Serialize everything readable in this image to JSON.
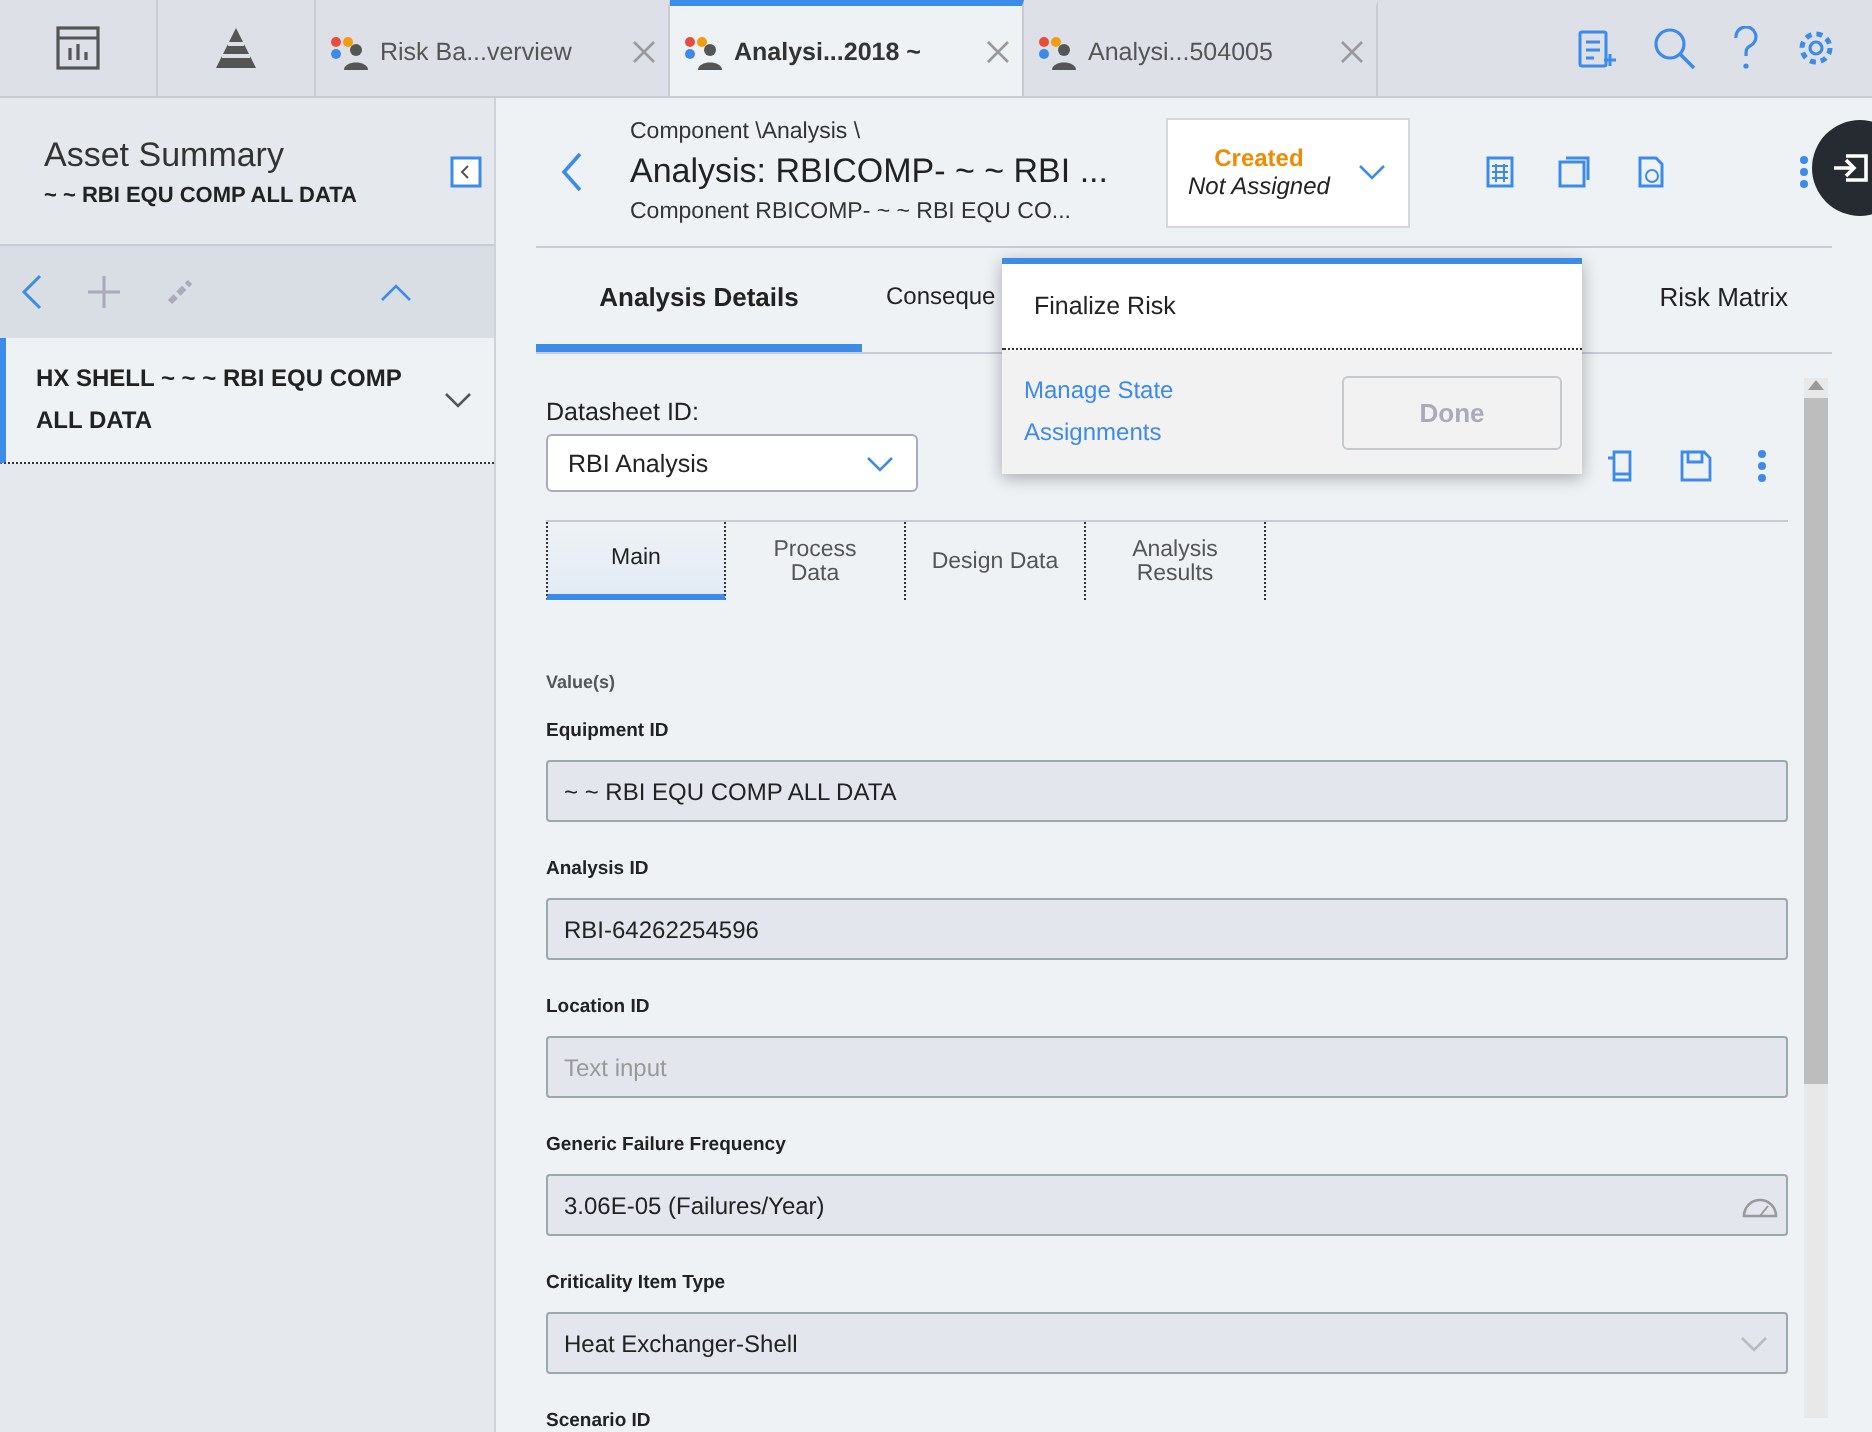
{
  "top_bar": {
    "tabs": [
      {
        "label": "Risk Ba...verview",
        "selected": false
      },
      {
        "label": "Analysi...2018 ~",
        "selected": true
      },
      {
        "label": "Analysi...504005",
        "selected": false
      }
    ]
  },
  "sidebar": {
    "title": "Asset Summary",
    "subtitle": "~ ~ RBI EQU COMP ALL DATA",
    "items": [
      {
        "label": "HX SHELL ~ ~ ~ RBI EQU COMP ALL DATA",
        "selected": true
      }
    ]
  },
  "header": {
    "breadcrumb": "Component \\Analysis \\",
    "title": "Analysis: RBICOMP- ~ ~ RBI ...",
    "subtitle": "Component RBICOMP- ~ ~ RBI EQU CO...",
    "state": {
      "name": "Created",
      "assignee": "Not Assigned"
    }
  },
  "tabs": [
    {
      "label": "Analysis Details",
      "selected": true
    },
    {
      "label": "Conseque",
      "selected": false
    },
    {
      "label": "Risk Matrix",
      "selected": false
    }
  ],
  "state_menu": {
    "title": "Finalize Risk",
    "link": "Manage State Assignments",
    "button": {
      "label": "Done",
      "disabled": true
    }
  },
  "datasheet": {
    "label": "Datasheet ID:",
    "value": "RBI Analysis"
  },
  "subtabs": [
    {
      "label": "Main",
      "selected": true
    },
    {
      "label": "Process Data",
      "selected": false
    },
    {
      "label": "Design Data",
      "selected": false
    },
    {
      "label": "Analysis Results",
      "selected": false
    }
  ],
  "section_label": "Value(s)",
  "fields": [
    {
      "label": "Equipment ID",
      "kind": "text",
      "value": "~  ~ RBI EQU COMP ALL DATA"
    },
    {
      "label": "Analysis ID",
      "kind": "text",
      "value": "RBI-64262254596"
    },
    {
      "label": "Location ID",
      "kind": "text",
      "placeholder": "Text input"
    },
    {
      "label": "Generic Failure Frequency",
      "kind": "gauge",
      "value": "3.06E-05 (Failures/Year)"
    },
    {
      "label": "Criticality Item Type",
      "kind": "dropdown",
      "value": "Heat Exchanger-Shell"
    },
    {
      "label": "Scenario ID",
      "kind": "label"
    }
  ]
}
